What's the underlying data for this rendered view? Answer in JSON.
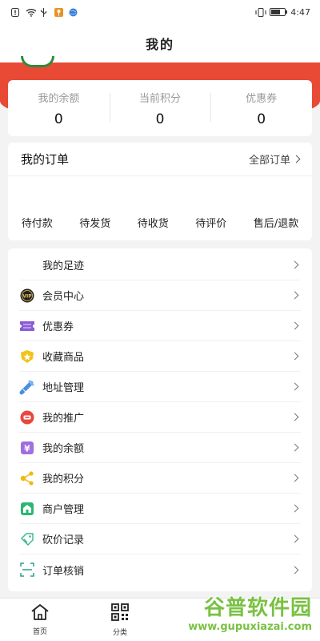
{
  "status": {
    "time": "4:47"
  },
  "header": {
    "title": "我的"
  },
  "stats": [
    {
      "label": "我的余额",
      "value": "0"
    },
    {
      "label": "当前积分",
      "value": "0"
    },
    {
      "label": "优惠券",
      "value": "0"
    }
  ],
  "orders": {
    "title": "我的订单",
    "all_label": "全部订单",
    "statuses": [
      "待付款",
      "待发货",
      "待收货",
      "待评价",
      "售后/退款"
    ]
  },
  "menu": [
    {
      "label": "我的足迹",
      "icon": "footprint-icon"
    },
    {
      "label": "会员中心",
      "icon": "vip-icon"
    },
    {
      "label": "优惠券",
      "icon": "coupon-icon"
    },
    {
      "label": "收藏商品",
      "icon": "star-icon"
    },
    {
      "label": "地址管理",
      "icon": "address-icon"
    },
    {
      "label": "我的推广",
      "icon": "promotion-icon"
    },
    {
      "label": "我的余额",
      "icon": "yuan-icon"
    },
    {
      "label": "我的积分",
      "icon": "points-icon"
    },
    {
      "label": "商户管理",
      "icon": "merchant-icon"
    },
    {
      "label": "砍价记录",
      "icon": "bargain-icon"
    },
    {
      "label": "订单核销",
      "icon": "scan-icon"
    }
  ],
  "tabs": [
    {
      "label": "首页",
      "icon": "home-icon"
    },
    {
      "label": "分类",
      "icon": "qrcode-icon"
    }
  ],
  "watermark": {
    "main": "谷普软件园",
    "url": "www.gupuxiazai.com"
  },
  "colors": {
    "accent": "#e84a36",
    "watermark": "#7ac143"
  }
}
